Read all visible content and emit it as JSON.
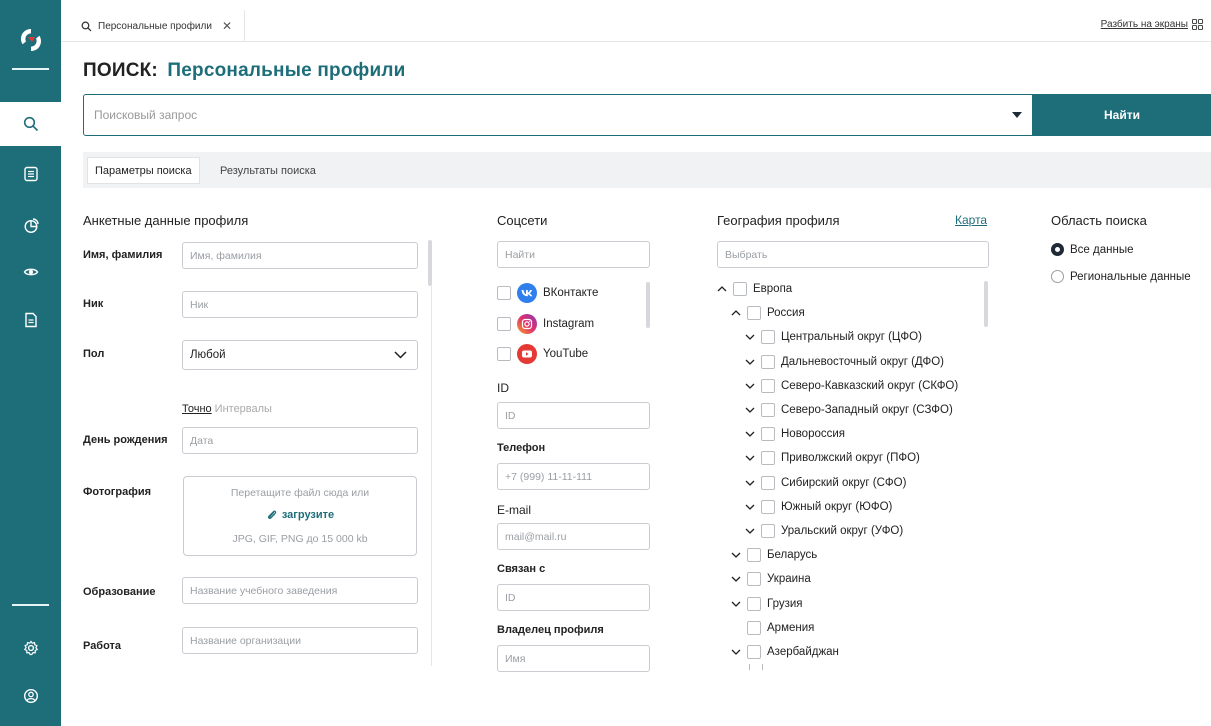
{
  "tab": {
    "label": "Персональные профили",
    "close": "✕"
  },
  "header": {
    "split_label": "Разбить на экраны"
  },
  "page": {
    "title_prefix": "ПОИСК:",
    "title_accent": "Персональные профили"
  },
  "search": {
    "placeholder": "Поисковый запрос",
    "button": "Найти"
  },
  "subtabs": [
    {
      "label": "Параметры поиска",
      "active": true
    },
    {
      "label": "Результаты поиска",
      "active": false
    }
  ],
  "profile": {
    "title": "Анкетные данные профиля",
    "name_label": "Имя, фамилия",
    "name_placeholder": "Имя, фамилия",
    "nick_label": "Ник",
    "nick_placeholder": "Ник",
    "gender_label": "Пол",
    "gender_value": "Любой",
    "mode_exact": "Точно",
    "mode_interval": "Интервалы",
    "birthday_label": "День рождения",
    "birthday_placeholder": "Дата",
    "photo_label": "Фотография",
    "photo_hint": "Перетащите файл сюда или",
    "photo_upload": "загрузите",
    "photo_formats": "JPG, GIF, PNG до 15 000 kb",
    "education_label": "Образование",
    "education_placeholder": "Название учебного заведения",
    "work_label": "Работа",
    "work_placeholder": "Название организации"
  },
  "social": {
    "title": "Соцсети",
    "search_placeholder": "Найти",
    "networks": [
      "ВКонтакте",
      "Instagram",
      "YouTube"
    ],
    "id_label": "ID",
    "id_placeholder": "ID",
    "phone_label": "Телефон",
    "phone_placeholder": "+7 (999) 11-11-111",
    "email_label": "E-mail",
    "email_placeholder": "mail@mail.ru",
    "linked_label": "Связан с",
    "linked_placeholder": "ID",
    "owner_label": "Владелец профиля",
    "owner_placeholder": "Имя"
  },
  "geo": {
    "title": "География профиля",
    "map_link": "Карта",
    "select_placeholder": "Выбрать",
    "tree": [
      {
        "label": "Европа",
        "level": 0,
        "chevron": "up"
      },
      {
        "label": "Россия",
        "level": 1,
        "chevron": "up"
      },
      {
        "label": "Центральный округ (ЦФО)",
        "level": 2,
        "chevron": "down"
      },
      {
        "label": "Дальневосточный округ (ДФО)",
        "level": 2,
        "chevron": "down"
      },
      {
        "label": "Северо-Кавказский округ (СКФО)",
        "level": 2,
        "chevron": "down"
      },
      {
        "label": "Северо-Западный округ (СЗФО)",
        "level": 2,
        "chevron": "down"
      },
      {
        "label": "Новороссия",
        "level": 2,
        "chevron": "down"
      },
      {
        "label": "Приволжский округ (ПФО)",
        "level": 2,
        "chevron": "down"
      },
      {
        "label": "Сибирский округ (СФО)",
        "level": 2,
        "chevron": "down"
      },
      {
        "label": "Южный округ (ЮФО)",
        "level": 2,
        "chevron": "down"
      },
      {
        "label": "Уральский округ (УФО)",
        "level": 2,
        "chevron": "down"
      },
      {
        "label": "Беларусь",
        "level": 1,
        "chevron": "down"
      },
      {
        "label": "Украина",
        "level": 1,
        "chevron": "down"
      },
      {
        "label": "Грузия",
        "level": 1,
        "chevron": "down"
      },
      {
        "label": "Армения",
        "level": 1,
        "chevron": "none"
      },
      {
        "label": "Азербайджан",
        "level": 1,
        "chevron": "down"
      }
    ]
  },
  "scope": {
    "title": "Область поиска",
    "options": [
      {
        "label": "Все данные",
        "selected": true
      },
      {
        "label": "Региональные данные",
        "selected": false
      }
    ]
  },
  "colors": {
    "accent": "#1e6e7a",
    "rail": "#1e6e7a",
    "vk": "#2f80ed",
    "youtube": "#e53935"
  }
}
